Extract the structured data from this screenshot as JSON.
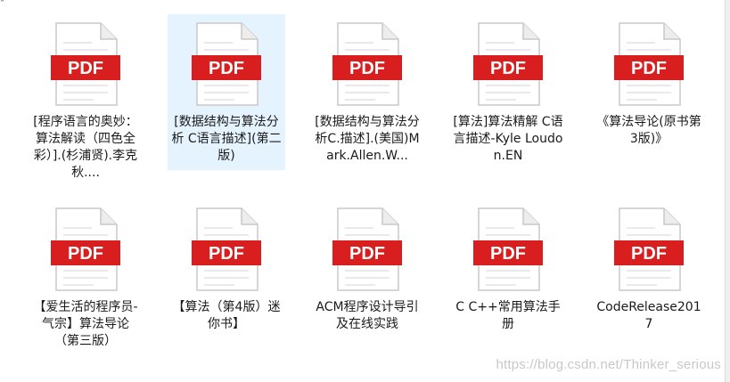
{
  "explorer": {
    "accent_selection": "#e5f3ff",
    "pdf_red": "#d81e1e",
    "icon_name": "pdf-file-icon",
    "icon_text": "PDF",
    "files": [
      {
        "name": "[程序语言的奥妙：算法解读（四色全彩）].(杉浦贤).李克秋...."
      },
      {
        "name": "[数据结构与算法分析 C语言描述](第二版)"
      },
      {
        "name": "[数据结构与算法分析C.描述].(美国)Mark.Allen.W..."
      },
      {
        "name": "[算法]算法精解 C语言描述-Kyle Loudon.EN"
      },
      {
        "name": "《算法导论(原书第3版)》"
      },
      {
        "name": "【爱生活的程序员-气宗】算法导论（第三版）"
      },
      {
        "name": "【算法（第4版）迷你书】"
      },
      {
        "name": "ACM程序设计导引及在线实践"
      },
      {
        "name": "C C++常用算法手册"
      },
      {
        "name": "CodeRelease2017"
      }
    ]
  },
  "watermark": "https://blog.csdn.net/Thinker_serious"
}
